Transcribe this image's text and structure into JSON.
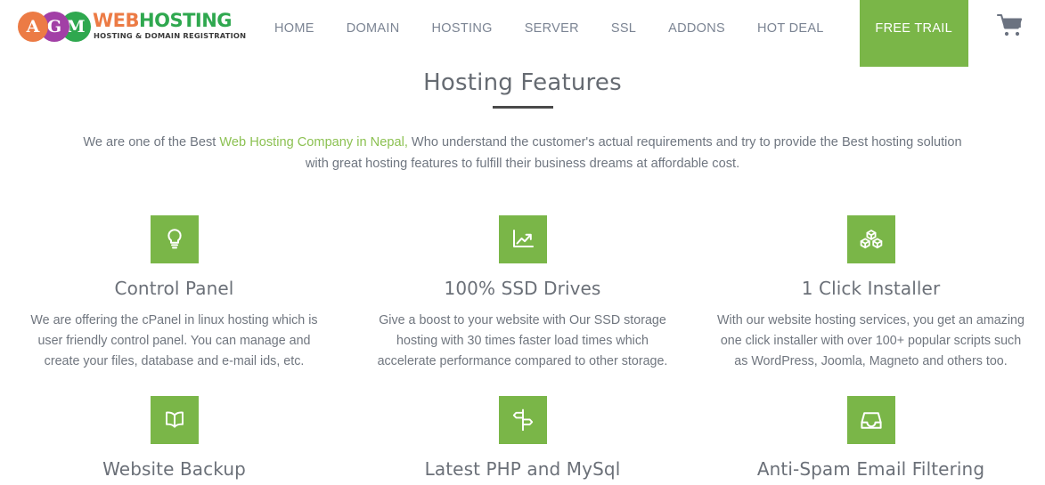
{
  "header": {
    "logo": {
      "circles": [
        {
          "letter": "A",
          "color": "#ec7b45"
        },
        {
          "letter": "G",
          "color": "#a23fa6"
        },
        {
          "letter": "M",
          "color": "#2fa84f"
        }
      ],
      "word_first": "WEB",
      "word_second": "HOSTING",
      "tagline": "HOSTING & DOMAIN REGISTRATION"
    },
    "nav": [
      {
        "label": "HOME",
        "active": false
      },
      {
        "label": "DOMAIN",
        "active": false
      },
      {
        "label": "HOSTING",
        "active": false
      },
      {
        "label": "SERVER",
        "active": false
      },
      {
        "label": "SSL",
        "active": false
      },
      {
        "label": "ADDONS",
        "active": false
      },
      {
        "label": "HOT DEAL",
        "active": false
      },
      {
        "label": "FREE TRAIL",
        "active": true
      }
    ],
    "cart_icon": "shopping-cart-icon"
  },
  "page": {
    "title": "Hosting Features",
    "intro_part1": "We are one of the Best ",
    "intro_link": "Web Hosting Company in Nepal,",
    "intro_part2": " Who understand the customer's actual requirements and try to provide the Best hosting solution with great hosting features to fulfill their business dreams at affordable cost."
  },
  "colors": {
    "brand_green": "#7ab648",
    "accent_link_green": "#8cc152",
    "text_grey": "#70767f",
    "heading_grey": "#6b7078"
  },
  "features": [
    {
      "icon": "lightbulb-icon",
      "title": "Control Panel",
      "text": "We are offering the cPanel in linux hosting which is user friendly control panel. You can manage and create your files, database and e-mail ids, etc."
    },
    {
      "icon": "growth-chart-icon",
      "title": "100% SSD Drives",
      "text": "Give a boost to your website with Our SSD storage hosting with 30 times faster load times which accelerate performance compared to other storage."
    },
    {
      "icon": "cubes-icon",
      "title": "1 Click Installer",
      "text": "With our website hosting services, you get an amazing one click installer with over 100+ popular scripts such as WordPress, Joomla, Magneto and others too."
    },
    {
      "icon": "open-book-icon",
      "title": "Website Backup",
      "text": ""
    },
    {
      "icon": "signpost-icon",
      "title": "Latest PHP and MySql",
      "text": ""
    },
    {
      "icon": "inbox-tray-icon",
      "title": "Anti-Spam Email Filtering",
      "text": ""
    }
  ]
}
